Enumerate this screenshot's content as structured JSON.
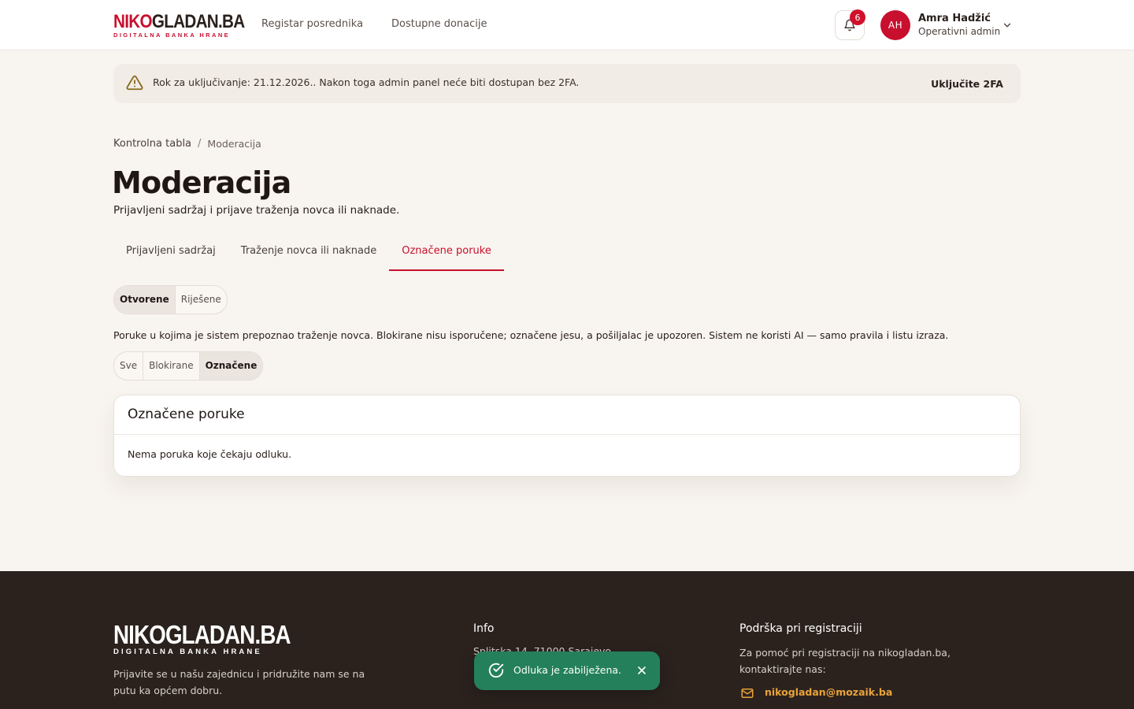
{
  "brand": {
    "logo_part1": "NIKO",
    "logo_part2": "GLADAN.BA",
    "tagline": "DIGITALNA BANKA HRANE",
    "footer_logo": "NIKOGLADAN.BA",
    "footer_tagline": "DIGITALNA BANKA HRANE",
    "accent_color": "#c8102e"
  },
  "nav": {
    "items": [
      {
        "label": "Registar posrednika"
      },
      {
        "label": "Dostupne donacije"
      }
    ]
  },
  "user": {
    "notification_count": "6",
    "initials": "AH",
    "name": "Amra Hadžić",
    "role": "Operativni admin"
  },
  "banner": {
    "text": "Rok za uključivanje: 21.12.2026.. Nakon toga admin panel neće biti dostupan bez 2FA.",
    "action": "Uključite 2FA",
    "icon": "warning-icon"
  },
  "breadcrumb": {
    "home": "Kontrolna tabla",
    "separator": "/",
    "current": "Moderacija"
  },
  "page": {
    "title": "Moderacija",
    "subtitle": "Prijavljeni sadržaj i prijave traženja novca ili naknade."
  },
  "tabs": [
    {
      "label": "Prijavljeni sadržaj",
      "active": false
    },
    {
      "label": "Traženje novca ili naknade",
      "active": false
    },
    {
      "label": "Označene poruke",
      "active": true
    }
  ],
  "status_filter": {
    "options": [
      {
        "label": "Otvorene",
        "active": true
      },
      {
        "label": "Riješene",
        "active": false
      }
    ]
  },
  "info_text": "Poruke u kojima je sistem prepoznao traženje novca. Blokirane nisu isporučene; označene jesu, a pošiljalac je upozoren. Sistem ne koristi AI — samo pravila i listu izraza.",
  "type_filter": {
    "options": [
      {
        "label": "Sve",
        "active": false
      },
      {
        "label": "Blokirane",
        "active": false
      },
      {
        "label": "Označene",
        "active": true
      }
    ]
  },
  "card": {
    "title": "Označene poruke",
    "empty_message": "Nema poruka koje čekaju odluku."
  },
  "footer": {
    "tagline": "Prijavite se u našu zajednicu i pridružite nam se na putu ka općem dobru.",
    "info_title": "Info",
    "address": "Splitska 14, 71000 Sarajevo",
    "support_title": "Podrška pri registraciji",
    "support_text": "Za pomoć pri registraciji na nikogladan.ba, kontaktirajte nas:",
    "email": "nikogladan@mozaik.ba",
    "email_color": "#e9a23b"
  },
  "toast": {
    "message": "Odluka je zabilježena.",
    "color": "#24805b"
  }
}
